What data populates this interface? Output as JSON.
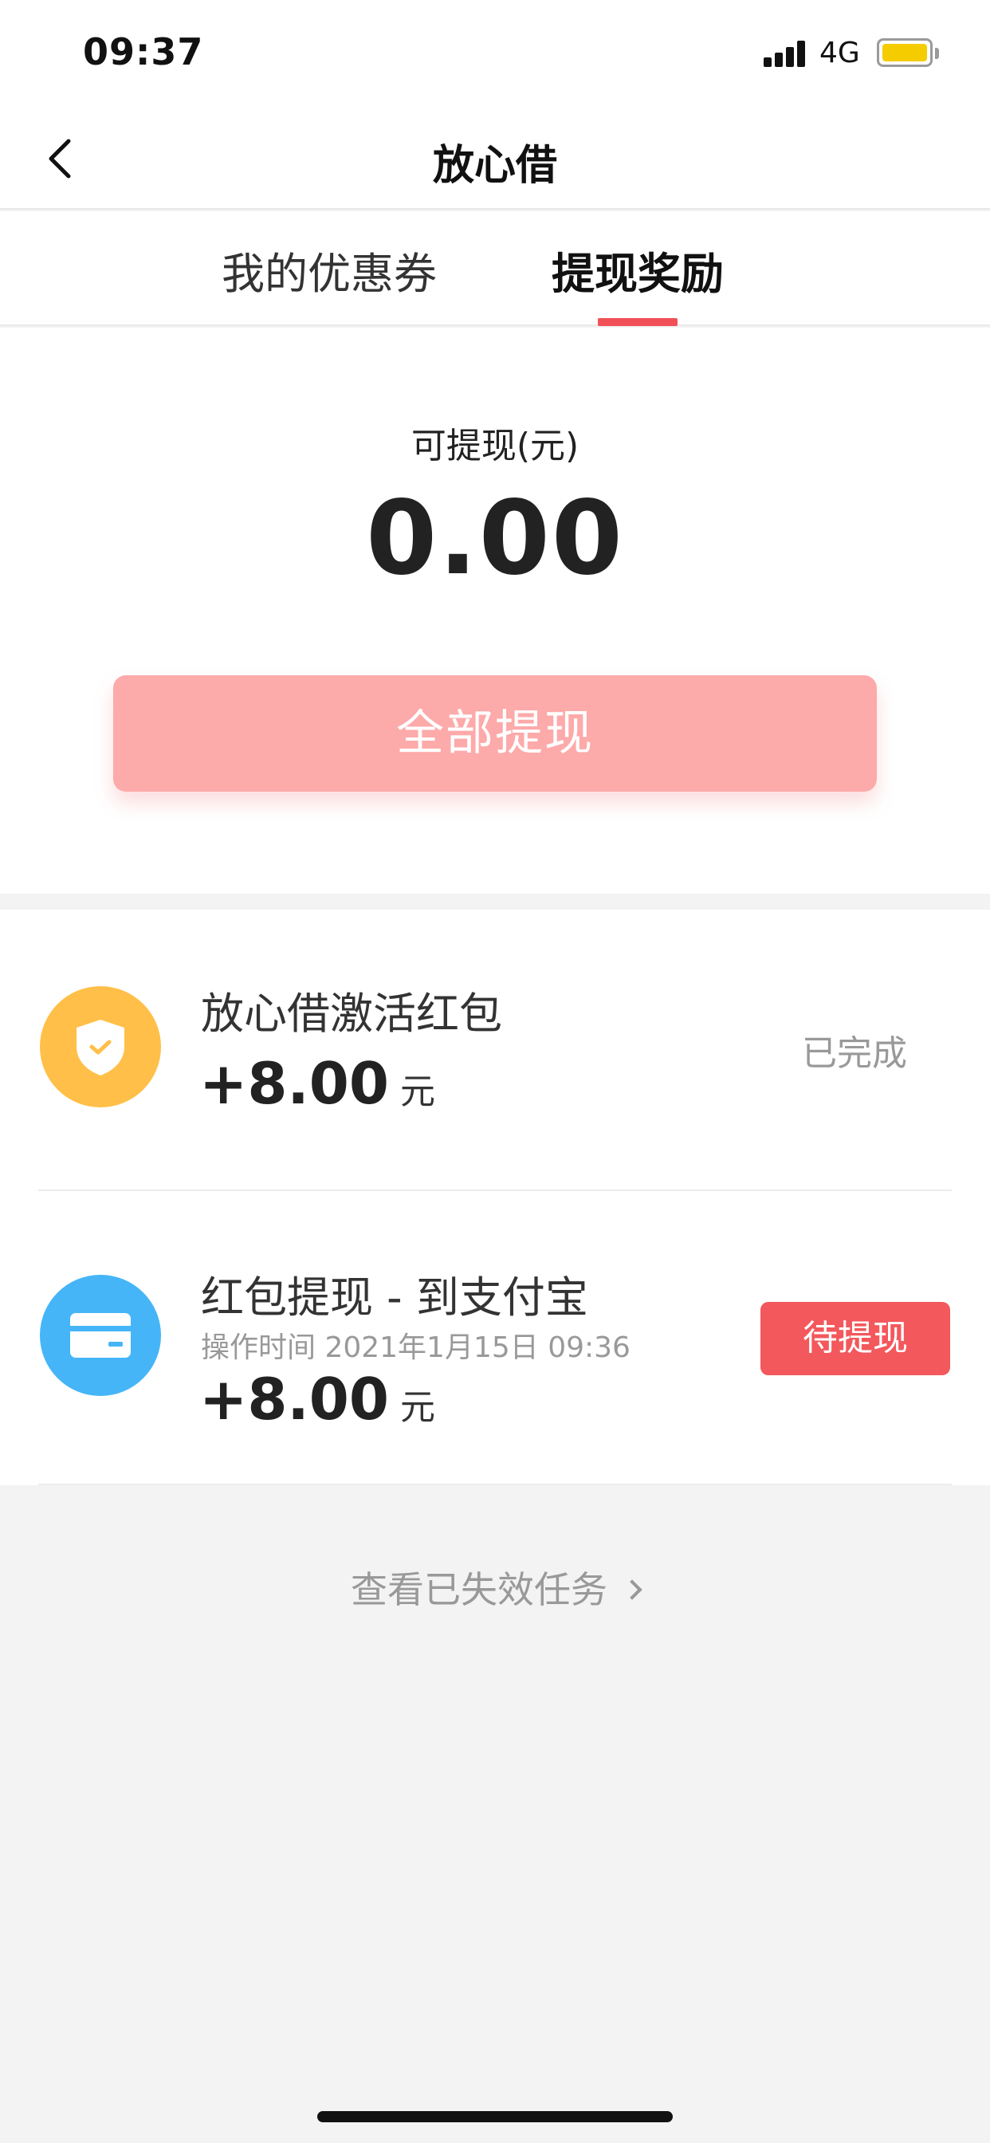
{
  "status_bar": {
    "time": "09:37",
    "network": "4G",
    "battery_color": "#f5cc00"
  },
  "nav": {
    "title": "放心借",
    "back_icon": "chevron-left-icon"
  },
  "tabs": [
    {
      "label": "我的优惠券",
      "active": false
    },
    {
      "label": "提现奖励",
      "active": true
    }
  ],
  "balance": {
    "label": "可提现(元)",
    "amount": "0.00",
    "button_label": "全部提现"
  },
  "items": [
    {
      "title": "放心借激活红包",
      "meta": "",
      "amount": "+8.00",
      "unit": "元",
      "status": "已完成",
      "icon": "shield-check-icon",
      "icon_color": "#ffbf48"
    },
    {
      "title": "红包提现 - 到支付宝",
      "meta": "操作时间 2021年1月15日 09:36",
      "amount": "+8.00",
      "unit": "元",
      "status": "待提现",
      "icon": "card-icon",
      "icon_color": "#45b5f7"
    }
  ],
  "footer": {
    "expired_link": "查看已失效任务"
  },
  "colors": {
    "accent": "#f25058",
    "button_disabled": "#fdaaaa",
    "pending_badge": "#f3585c"
  }
}
